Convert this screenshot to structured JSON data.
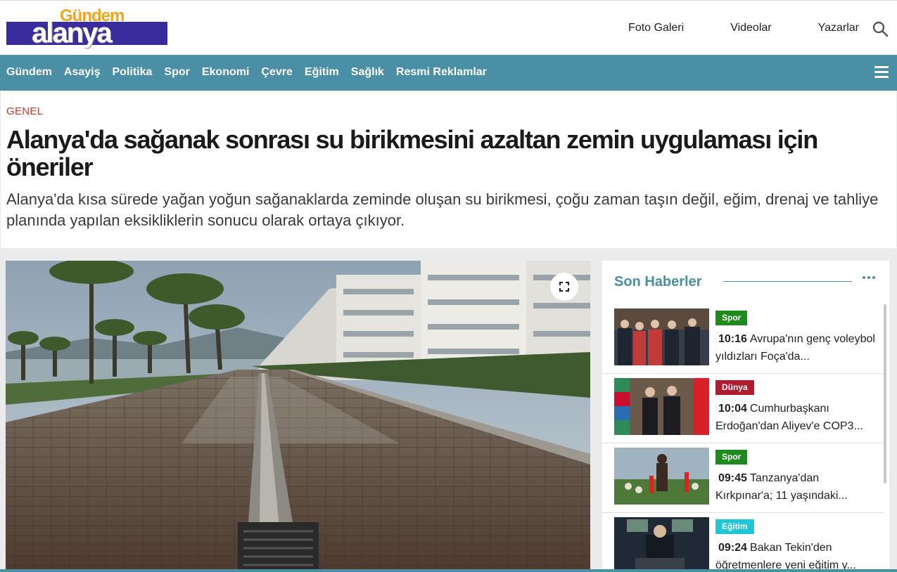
{
  "brand": {
    "logo_top": "Gündem",
    "logo_main": "alanya"
  },
  "top_links": [
    "Foto Galeri",
    "Videolar",
    "Yazarlar"
  ],
  "nav": [
    "Gündem",
    "Asayiş",
    "Politika",
    "Spor",
    "Ekonomi",
    "Çevre",
    "Eğitim",
    "Sağlık",
    "Resmi Reklamlar"
  ],
  "article": {
    "category": "GENEL",
    "title": "Alanya'da sağanak sonrası su birikmesini azaltan zemin uygulaması için öneriler",
    "summary": "Alanya'da kısa sürede yağan yoğun sağanaklarda zeminde oluşan su birikmesi, çoğu zaman taşın değil, eğim, drenaj ve tahliye planında yapılan eksikliklerin sonucu olarak ortaya çıkıyor."
  },
  "sidebar": {
    "title": "Son Haberler",
    "items": [
      {
        "badge": "Spor",
        "badge_color": "#1e8a1e",
        "time": "10:16",
        "text": "Avrupa'nın genç voleybol yıldızları Foça'da..."
      },
      {
        "badge": "Dünya",
        "badge_color": "#b01b2e",
        "time": "10:04",
        "text": "Cumhurbaşkanı Erdoğan'dan Aliyev'e COP3..."
      },
      {
        "badge": "Spor",
        "badge_color": "#1e8a1e",
        "time": "09:45",
        "text": "Tanzanya'dan Kırkpınar'a; 11 yaşındaki..."
      },
      {
        "badge": "Eğitim",
        "badge_color": "#1ec6d6",
        "time": "09:24",
        "text": "Bakan Tekin'den öğretmenlere yeni eğitim y..."
      }
    ]
  },
  "colors": {
    "accent": "#4a8fa5",
    "category": "#c0392b",
    "logo_bar": "#3b2c9e",
    "logo_top": "#f2a51a"
  }
}
